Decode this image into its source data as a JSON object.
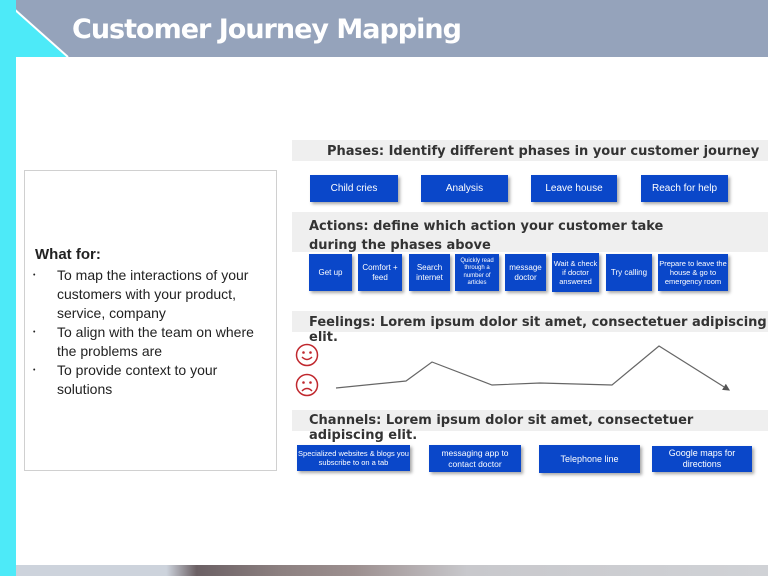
{
  "title": "Customer Journey Mapping",
  "left_panel": {
    "heading": "What for:",
    "bullets": [
      "To map the interactions of your customers with your product, service, company",
      "To align with the team on where the problems are",
      "To provide context to your solutions"
    ]
  },
  "phases": {
    "heading": "Phases: Identify different phases in your customer journey",
    "items": [
      "Child cries",
      "Analysis",
      "Leave house",
      "Reach for help"
    ]
  },
  "actions": {
    "heading": "Actions: define which action your customer take during the phases above",
    "items": [
      "Get up",
      "Comfort + feed",
      "Search internet",
      "Quickly read through a number of articles",
      "message doctor",
      "Wait & check if doctor answered",
      "Try calling",
      "Prepare to leave the house & go to emergency room"
    ]
  },
  "feelings": {
    "heading": "Feelings: Lorem ipsum dolor sit amet, consectetuer adipiscing elit.",
    "icons": [
      "happy-face-icon",
      "sad-face-icon"
    ]
  },
  "channels": {
    "heading": "Channels: Lorem ipsum dolor sit amet, consectetuer adipiscing elit.",
    "items": [
      "Specialized websites & blogs you subscribe to on a tab",
      "messaging app to contact doctor",
      "Telephone line",
      "Google maps for directions"
    ]
  },
  "colors": {
    "accent": "#4deaf8",
    "header": "#95a3bb",
    "button": "#0a47c9",
    "face": "#c0272d"
  }
}
